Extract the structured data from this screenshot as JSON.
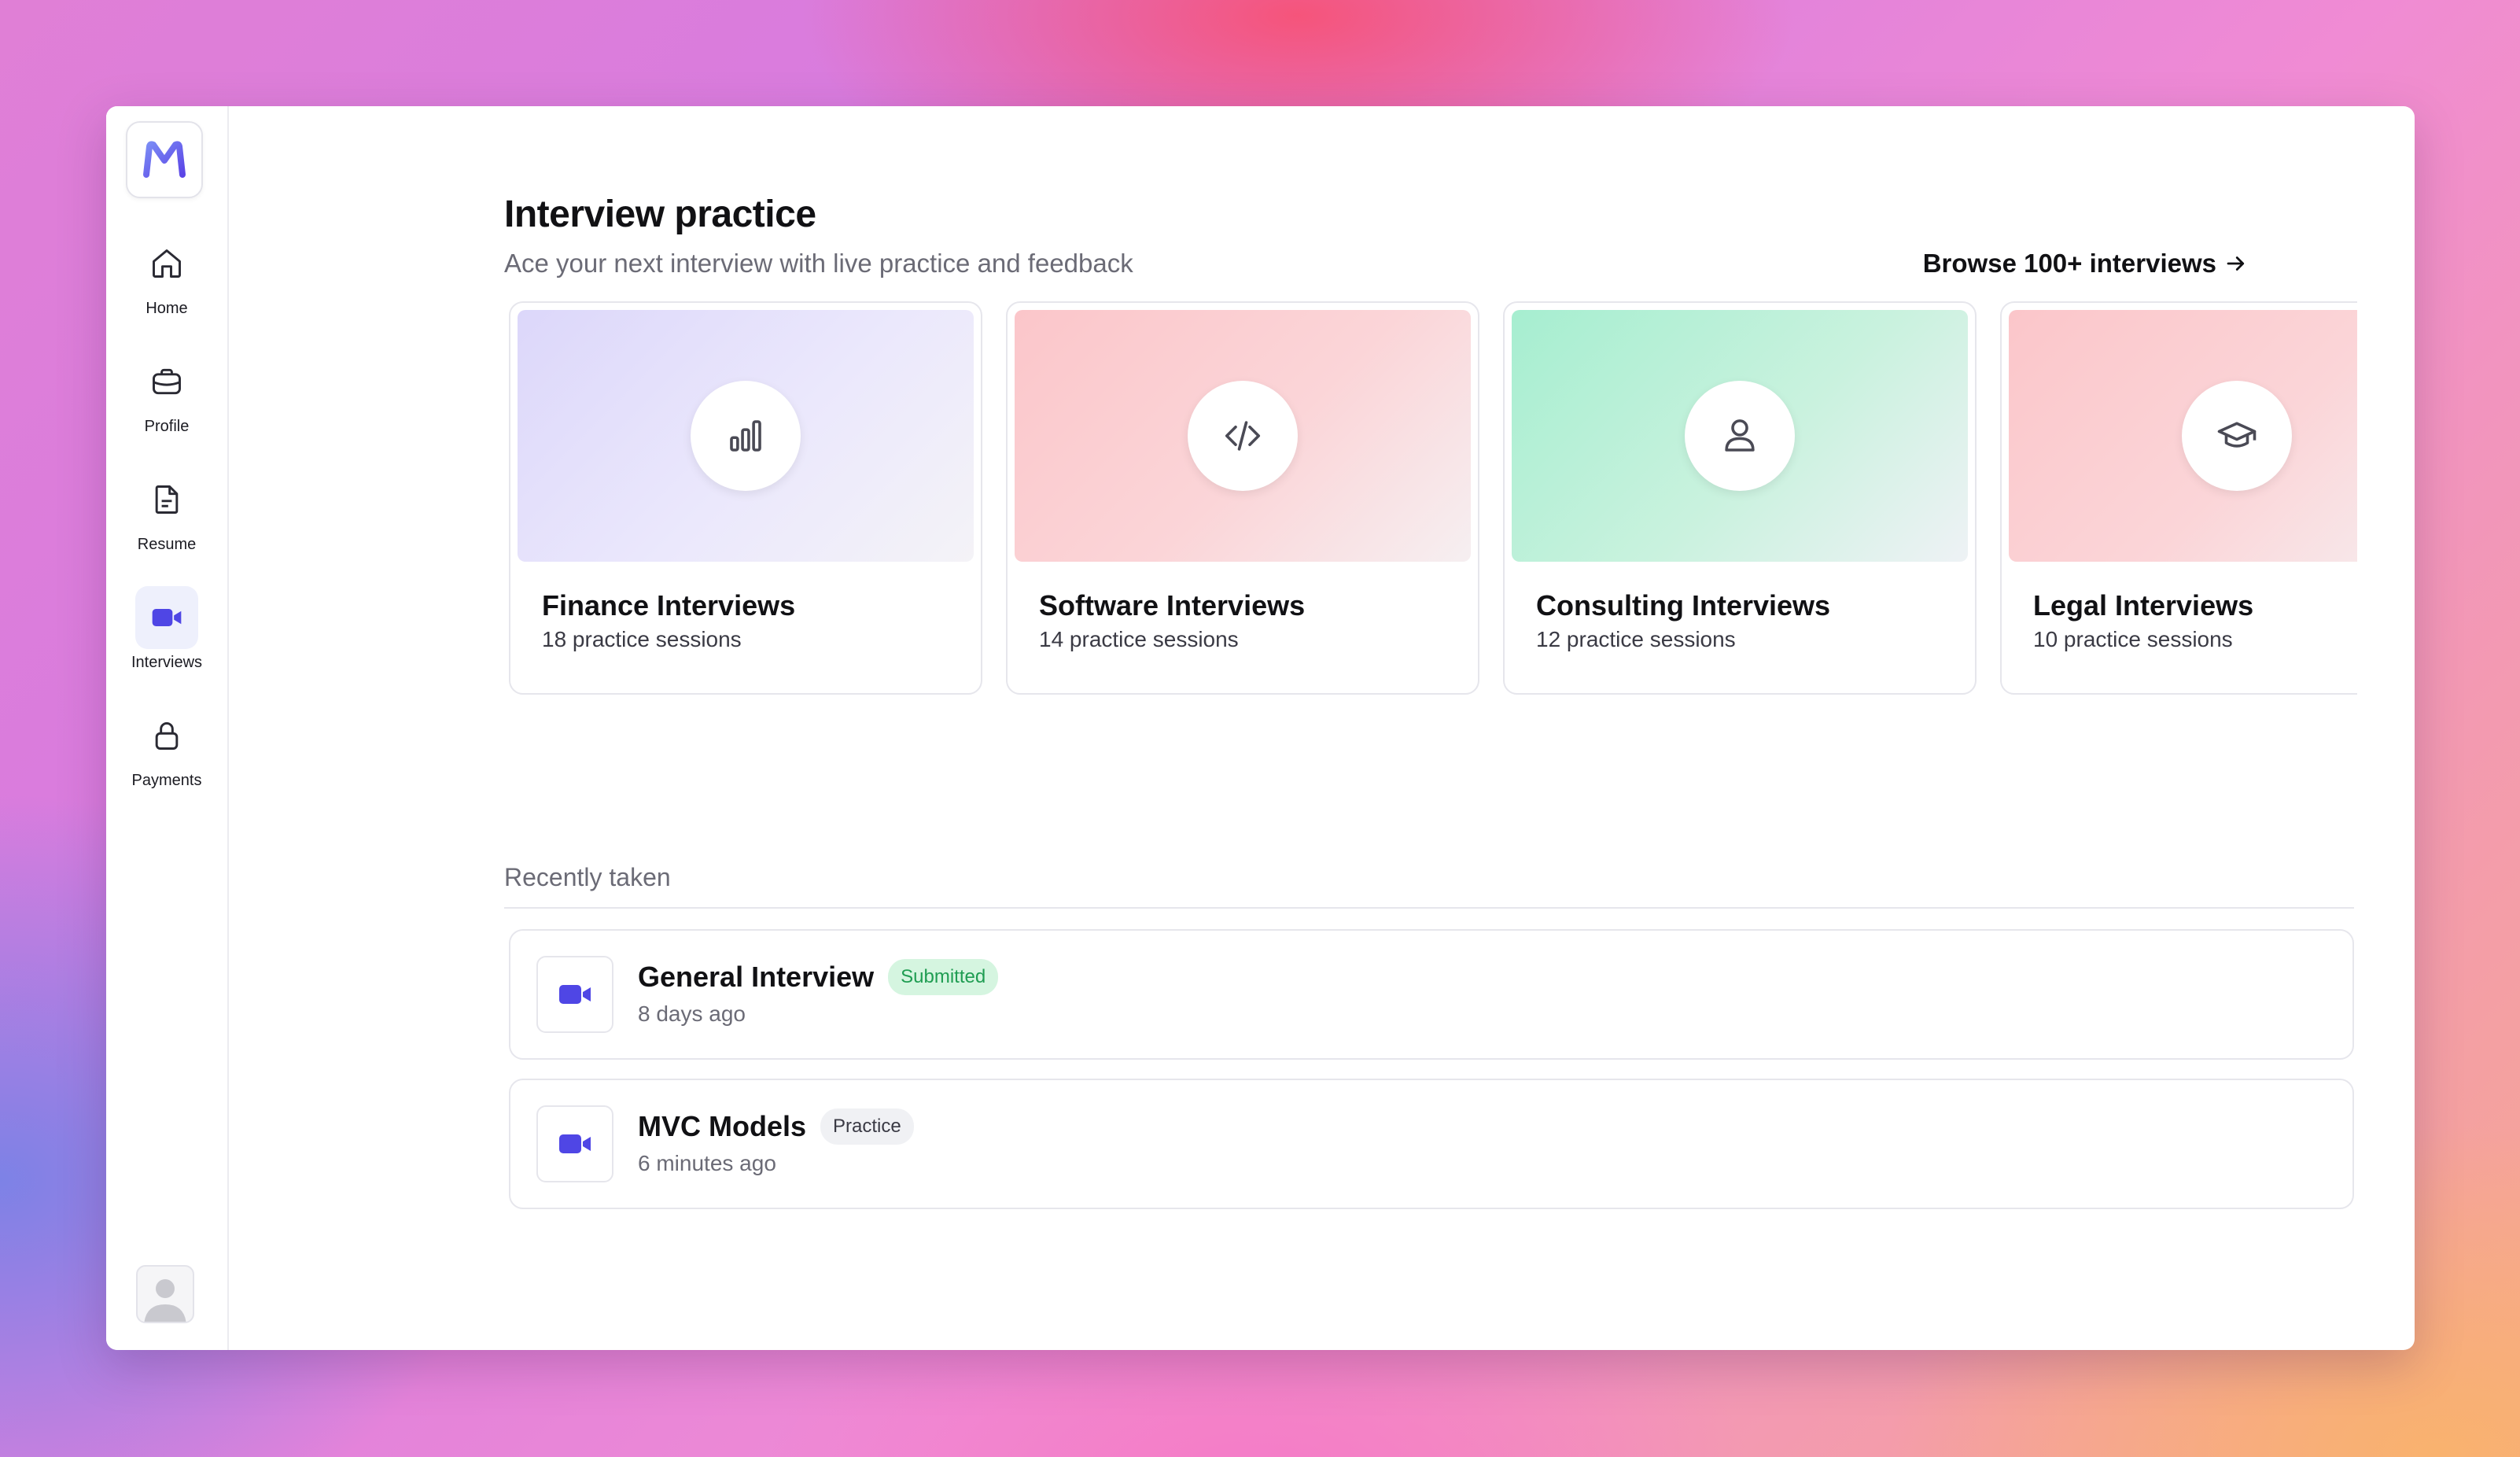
{
  "sidebar": {
    "logo_letter": "M",
    "items": [
      {
        "label": "Home",
        "icon": "home-icon",
        "active": false
      },
      {
        "label": "Profile",
        "icon": "briefcase-icon",
        "active": false
      },
      {
        "label": "Resume",
        "icon": "document-icon",
        "active": false
      },
      {
        "label": "Interviews",
        "icon": "video-camera-icon",
        "active": true
      },
      {
        "label": "Payments",
        "icon": "lock-icon",
        "active": false
      }
    ]
  },
  "header": {
    "title": "Interview practice",
    "subtitle": "Ace your next interview with live practice and feedback",
    "browse_link": "Browse 100+ interviews"
  },
  "categories": [
    {
      "title": "Finance Interviews",
      "sessions": "18 practice sessions",
      "icon": "bar-chart-icon"
    },
    {
      "title": "Software Interviews",
      "sessions": "14 practice sessions",
      "icon": "code-icon"
    },
    {
      "title": "Consulting Interviews",
      "sessions": "12 practice sessions",
      "icon": "person-icon"
    },
    {
      "title": "Legal Interviews",
      "sessions": "10 practice sessions",
      "icon": "graduation-cap-icon"
    }
  ],
  "recent": {
    "label": "Recently taken",
    "items": [
      {
        "title": "General Interview",
        "badge": "Submitted",
        "time": "8 days ago"
      },
      {
        "title": "MVC Models",
        "badge": "Practice",
        "time": "6 minutes ago"
      }
    ]
  },
  "help": {
    "label": "?"
  },
  "colors": {
    "accent": "#4f46e5",
    "finance_banner": "#e4e0fb",
    "software_banner": "#fbcfd2",
    "consulting_banner": "#b4f0d6",
    "legal_banner": "#fbcfd2",
    "submitted_badge": "#d5f5e0"
  }
}
